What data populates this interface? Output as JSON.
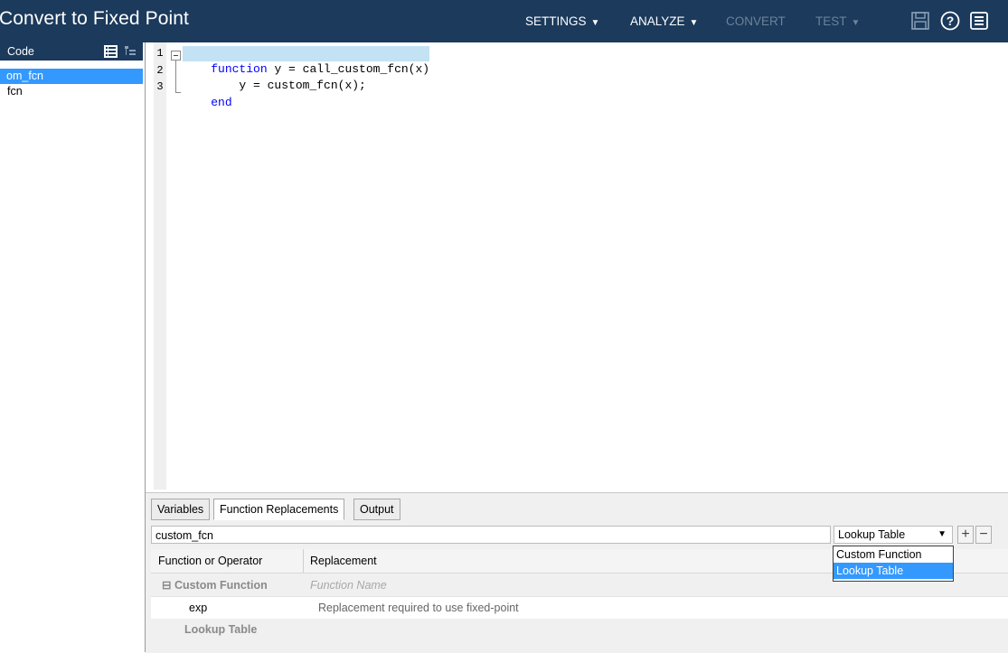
{
  "header": {
    "title": "Convert to Fixed Point",
    "menus": [
      {
        "label": "SETTINGS",
        "enabled": true
      },
      {
        "label": "ANALYZE",
        "enabled": true
      },
      {
        "label": "CONVERT",
        "enabled": false
      },
      {
        "label": "TEST",
        "enabled": false
      }
    ],
    "icons": [
      "save-icon",
      "help-icon",
      "menu-icon"
    ]
  },
  "left_panel": {
    "header_label": "Code",
    "items": [
      {
        "label": "om_fcn",
        "selected": true
      },
      {
        "label": "fcn",
        "selected": false
      }
    ]
  },
  "editor": {
    "lines": [
      {
        "num": "1",
        "keyword": "function",
        "text": " y = call_custom_fcn(x)"
      },
      {
        "num": "2",
        "keyword": "",
        "text": "    y = custom_fcn(x);"
      },
      {
        "num": "3",
        "keyword": "end",
        "text": ""
      }
    ]
  },
  "bottom": {
    "tabs": [
      {
        "label": "Variables"
      },
      {
        "label": "Function Replacements"
      },
      {
        "label": "Output"
      }
    ],
    "function_input": "custom_fcn",
    "replacement_type": "Lookup Table",
    "add_label": "+",
    "remove_label": "−",
    "columns": [
      "Function or Operator",
      "Replacement"
    ],
    "rows": [
      {
        "col1": "⊟ Custom Function",
        "col2": "Function Name"
      },
      {
        "col1": "exp",
        "col2": "Replacement required to use fixed-point"
      },
      {
        "col1": "Lookup Table",
        "col2": ""
      }
    ],
    "dropdown_options": [
      "Custom Function",
      "Lookup Table"
    ]
  },
  "colors": {
    "title_bar": "#1b3a5c",
    "selection": "#3399ff",
    "code_highlight": "#c3e2f3",
    "keyword": "#0000ff"
  }
}
